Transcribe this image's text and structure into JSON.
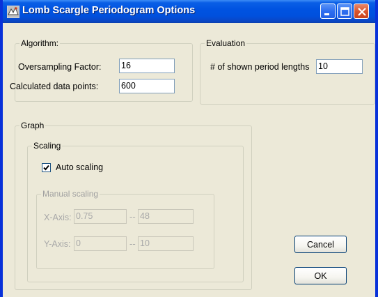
{
  "window": {
    "title": "Lomb Scargle Periodogram Options",
    "title_icon": "app-icon",
    "controls": [
      "minimize-icon",
      "maximize-icon",
      "close-icon"
    ],
    "title_bar_color": "#0a5fe6"
  },
  "algorithm": {
    "legend": "Algorithm:",
    "oversampling_label": "Oversampling Factor:",
    "oversampling_value": "16",
    "datapoints_label": "Calculated data points:",
    "datapoints_value": "600"
  },
  "evaluation": {
    "legend": "Evaluation",
    "periods_label": "# of shown period lengths",
    "periods_value": "10"
  },
  "graph": {
    "legend": "Graph",
    "scaling": {
      "legend": "Scaling",
      "auto_label": "Auto scaling",
      "auto_checked": true,
      "manual": {
        "legend": "Manual scaling",
        "x_label": "X-Axis:",
        "x_min": "0.75",
        "x_max": "48",
        "y_label": "Y-Axis:",
        "y_min": "0",
        "y_max": "10",
        "separator": "--"
      }
    }
  },
  "buttons": {
    "cancel": "Cancel",
    "ok": "OK"
  }
}
